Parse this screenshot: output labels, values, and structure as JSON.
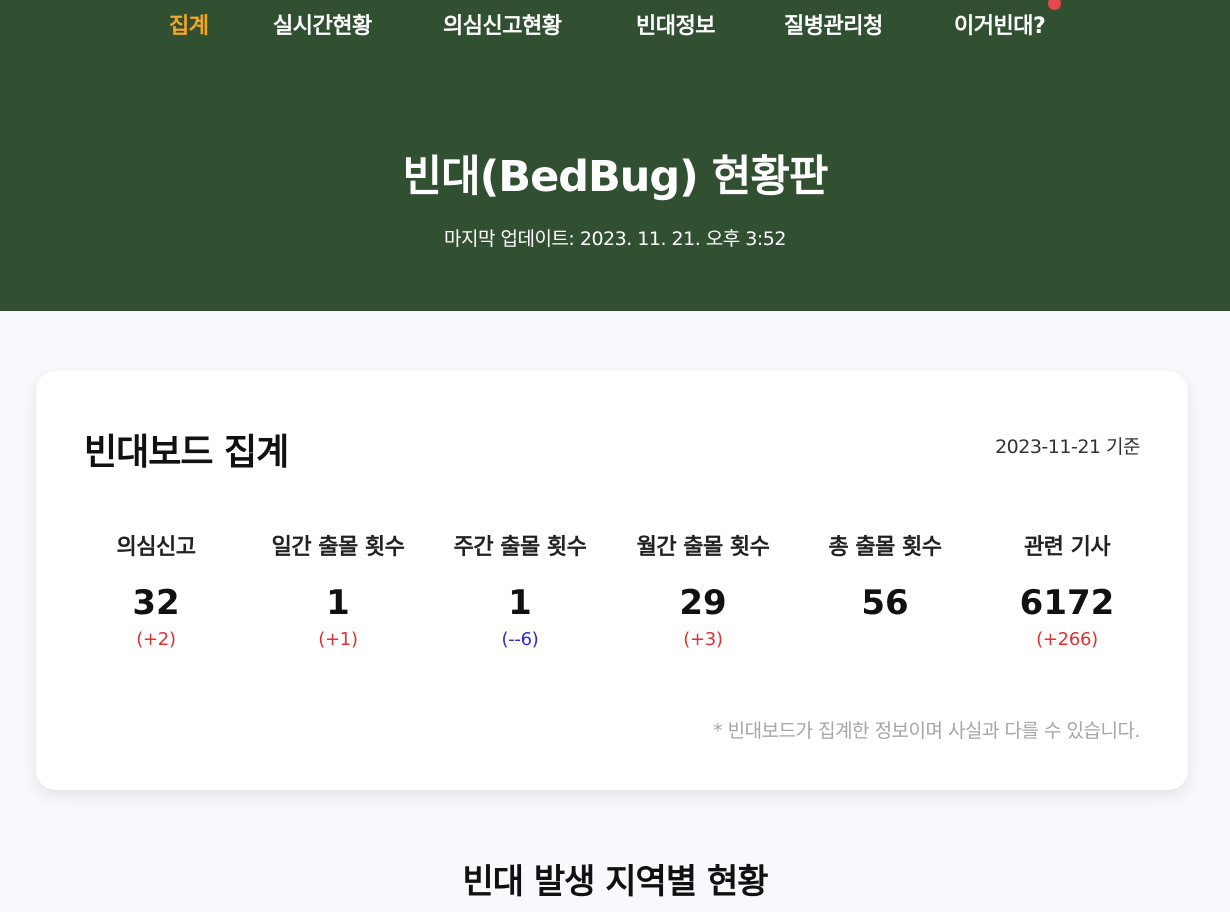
{
  "nav": {
    "items": [
      {
        "label": "집계"
      },
      {
        "label": "실시간현황"
      },
      {
        "label": "의심신고현황"
      },
      {
        "label": "빈대정보"
      },
      {
        "label": "질병관리청"
      },
      {
        "label": "이거빈대?"
      }
    ],
    "active_index": 0
  },
  "hero": {
    "title": "빈대(BedBug) 현황판",
    "subtitle": "마지막 업데이트: 2023. 11. 21. 오후 3:52"
  },
  "summary": {
    "title": "빈대보드 집계",
    "date": "2023-11-21 기준",
    "stats": [
      {
        "label": "의심신고",
        "value": "32",
        "delta": "(+2)",
        "trend": "up"
      },
      {
        "label": "일간 출몰 횟수",
        "value": "1",
        "delta": "(+1)",
        "trend": "up"
      },
      {
        "label": "주간 출몰 횟수",
        "value": "1",
        "delta": "(--6)",
        "trend": "down"
      },
      {
        "label": "월간 출몰 횟수",
        "value": "29",
        "delta": "(+3)",
        "trend": "up"
      },
      {
        "label": "총 출몰 횟수",
        "value": "56",
        "delta": "",
        "trend": "none"
      },
      {
        "label": "관련 기사",
        "value": "6172",
        "delta": "(+266)",
        "trend": "up"
      }
    ],
    "note": "* 빈대보드가 집계한 정보이며 사실과 다를 수 있습니다."
  },
  "region_section": {
    "title": "빈대 발생 지역별 현황"
  },
  "colors": {
    "header_bg": "#314f31",
    "nav_active": "#f5a623",
    "delta_up": "#e03030",
    "delta_down": "#2b2bd6",
    "notification_dot": "#e5484d"
  }
}
